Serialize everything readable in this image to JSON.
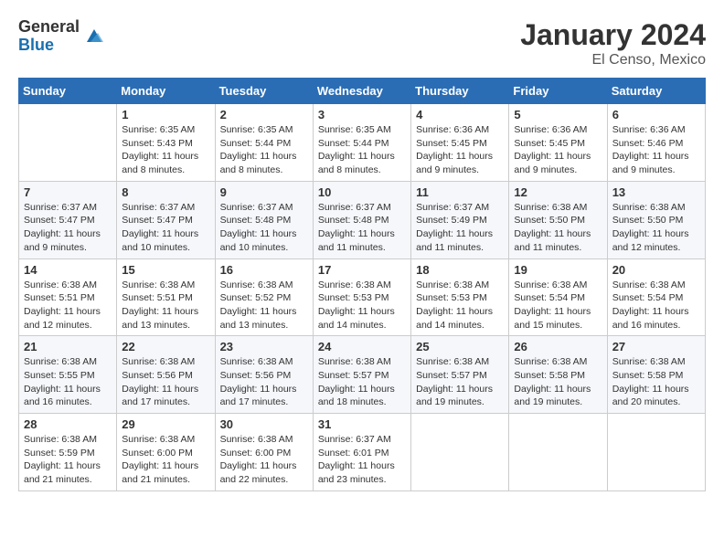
{
  "logo": {
    "general": "General",
    "blue": "Blue"
  },
  "header": {
    "month": "January 2024",
    "location": "El Censo, Mexico"
  },
  "weekdays": [
    "Sunday",
    "Monday",
    "Tuesday",
    "Wednesday",
    "Thursday",
    "Friday",
    "Saturday"
  ],
  "weeks": [
    [
      {
        "day": "",
        "info": ""
      },
      {
        "day": "1",
        "info": "Sunrise: 6:35 AM\nSunset: 5:43 PM\nDaylight: 11 hours\nand 8 minutes."
      },
      {
        "day": "2",
        "info": "Sunrise: 6:35 AM\nSunset: 5:44 PM\nDaylight: 11 hours\nand 8 minutes."
      },
      {
        "day": "3",
        "info": "Sunrise: 6:35 AM\nSunset: 5:44 PM\nDaylight: 11 hours\nand 8 minutes."
      },
      {
        "day": "4",
        "info": "Sunrise: 6:36 AM\nSunset: 5:45 PM\nDaylight: 11 hours\nand 9 minutes."
      },
      {
        "day": "5",
        "info": "Sunrise: 6:36 AM\nSunset: 5:45 PM\nDaylight: 11 hours\nand 9 minutes."
      },
      {
        "day": "6",
        "info": "Sunrise: 6:36 AM\nSunset: 5:46 PM\nDaylight: 11 hours\nand 9 minutes."
      }
    ],
    [
      {
        "day": "7",
        "info": "Sunrise: 6:37 AM\nSunset: 5:47 PM\nDaylight: 11 hours\nand 9 minutes."
      },
      {
        "day": "8",
        "info": "Sunrise: 6:37 AM\nSunset: 5:47 PM\nDaylight: 11 hours\nand 10 minutes."
      },
      {
        "day": "9",
        "info": "Sunrise: 6:37 AM\nSunset: 5:48 PM\nDaylight: 11 hours\nand 10 minutes."
      },
      {
        "day": "10",
        "info": "Sunrise: 6:37 AM\nSunset: 5:48 PM\nDaylight: 11 hours\nand 11 minutes."
      },
      {
        "day": "11",
        "info": "Sunrise: 6:37 AM\nSunset: 5:49 PM\nDaylight: 11 hours\nand 11 minutes."
      },
      {
        "day": "12",
        "info": "Sunrise: 6:38 AM\nSunset: 5:50 PM\nDaylight: 11 hours\nand 11 minutes."
      },
      {
        "day": "13",
        "info": "Sunrise: 6:38 AM\nSunset: 5:50 PM\nDaylight: 11 hours\nand 12 minutes."
      }
    ],
    [
      {
        "day": "14",
        "info": "Sunrise: 6:38 AM\nSunset: 5:51 PM\nDaylight: 11 hours\nand 12 minutes."
      },
      {
        "day": "15",
        "info": "Sunrise: 6:38 AM\nSunset: 5:51 PM\nDaylight: 11 hours\nand 13 minutes."
      },
      {
        "day": "16",
        "info": "Sunrise: 6:38 AM\nSunset: 5:52 PM\nDaylight: 11 hours\nand 13 minutes."
      },
      {
        "day": "17",
        "info": "Sunrise: 6:38 AM\nSunset: 5:53 PM\nDaylight: 11 hours\nand 14 minutes."
      },
      {
        "day": "18",
        "info": "Sunrise: 6:38 AM\nSunset: 5:53 PM\nDaylight: 11 hours\nand 14 minutes."
      },
      {
        "day": "19",
        "info": "Sunrise: 6:38 AM\nSunset: 5:54 PM\nDaylight: 11 hours\nand 15 minutes."
      },
      {
        "day": "20",
        "info": "Sunrise: 6:38 AM\nSunset: 5:54 PM\nDaylight: 11 hours\nand 16 minutes."
      }
    ],
    [
      {
        "day": "21",
        "info": "Sunrise: 6:38 AM\nSunset: 5:55 PM\nDaylight: 11 hours\nand 16 minutes."
      },
      {
        "day": "22",
        "info": "Sunrise: 6:38 AM\nSunset: 5:56 PM\nDaylight: 11 hours\nand 17 minutes."
      },
      {
        "day": "23",
        "info": "Sunrise: 6:38 AM\nSunset: 5:56 PM\nDaylight: 11 hours\nand 17 minutes."
      },
      {
        "day": "24",
        "info": "Sunrise: 6:38 AM\nSunset: 5:57 PM\nDaylight: 11 hours\nand 18 minutes."
      },
      {
        "day": "25",
        "info": "Sunrise: 6:38 AM\nSunset: 5:57 PM\nDaylight: 11 hours\nand 19 minutes."
      },
      {
        "day": "26",
        "info": "Sunrise: 6:38 AM\nSunset: 5:58 PM\nDaylight: 11 hours\nand 19 minutes."
      },
      {
        "day": "27",
        "info": "Sunrise: 6:38 AM\nSunset: 5:58 PM\nDaylight: 11 hours\nand 20 minutes."
      }
    ],
    [
      {
        "day": "28",
        "info": "Sunrise: 6:38 AM\nSunset: 5:59 PM\nDaylight: 11 hours\nand 21 minutes."
      },
      {
        "day": "29",
        "info": "Sunrise: 6:38 AM\nSunset: 6:00 PM\nDaylight: 11 hours\nand 21 minutes."
      },
      {
        "day": "30",
        "info": "Sunrise: 6:38 AM\nSunset: 6:00 PM\nDaylight: 11 hours\nand 22 minutes."
      },
      {
        "day": "31",
        "info": "Sunrise: 6:37 AM\nSunset: 6:01 PM\nDaylight: 11 hours\nand 23 minutes."
      },
      {
        "day": "",
        "info": ""
      },
      {
        "day": "",
        "info": ""
      },
      {
        "day": "",
        "info": ""
      }
    ]
  ]
}
